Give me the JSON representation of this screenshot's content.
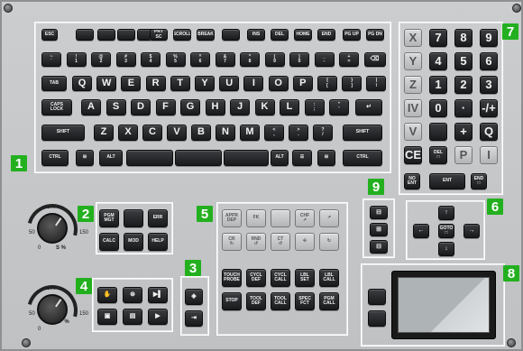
{
  "section_labels": {
    "1": "1",
    "2": "2",
    "3": "3",
    "4": "4",
    "5": "5",
    "6": "6",
    "7": "7",
    "8": "8",
    "9": "9"
  },
  "keyboard": {
    "row1": [
      "ESC",
      "",
      "",
      "",
      "",
      "PRT\nSC",
      "SCROLL",
      "BREAK",
      "",
      "INS",
      "DEL",
      "HOME",
      "END",
      "PG UP",
      "PG DN"
    ],
    "row2": [
      "~\n`",
      "!\n1",
      "@\n2",
      "#\n3",
      "$\n4",
      "%\n5",
      "^\n6",
      "&\n7",
      "*\n8",
      "(\n9",
      ")\n0",
      "_\n-",
      "+\n=",
      "⌫"
    ],
    "row3": [
      "TAB",
      "Q",
      "W",
      "E",
      "R",
      "T",
      "Y",
      "U",
      "I",
      "O",
      "P",
      "{\n[",
      "}\n]",
      "|\n\\"
    ],
    "row4": [
      "CAPS\nLOCK",
      "A",
      "S",
      "D",
      "F",
      "G",
      "H",
      "J",
      "K",
      "L",
      ":\n;",
      "\"\n'",
      "↵"
    ],
    "row5": [
      "SHIFT",
      "Z",
      "X",
      "C",
      "V",
      "B",
      "N",
      "M",
      "<\n,",
      ">\n.",
      "?\n/",
      "SHIFT"
    ],
    "row6": [
      "CTRL",
      "⊞",
      "ALT",
      "",
      "",
      "",
      "ALT",
      "☰",
      "⊞",
      "CTRL"
    ]
  },
  "numpad": {
    "rows": [
      [
        "X",
        "7",
        "8",
        "9"
      ],
      [
        "Y",
        "4",
        "5",
        "6"
      ],
      [
        "Z",
        "1",
        "2",
        "3"
      ],
      [
        "IV",
        "0",
        "·",
        "-/+"
      ],
      [
        "V",
        "",
        "+",
        "Q"
      ],
      [
        "CE",
        "DEL\n□",
        "P",
        "I"
      ],
      [
        "NO\nENT",
        "ENT",
        "",
        "END\n□"
      ]
    ]
  },
  "section2": [
    "PGM\nMGT",
    "",
    "ERR",
    "CALC",
    "MOD",
    "HELP"
  ],
  "section3": [
    "◈",
    "⇥"
  ],
  "section4": [
    "✋",
    "⊛",
    "▶▌",
    "▣",
    "▤",
    "▶"
  ],
  "section5": [
    "APPR\nDEP",
    "FK",
    "",
    "CHF\n↗",
    "↗",
    "CR\n↻",
    "RND\n↺",
    "CT\n↺",
    "✣",
    "↻",
    "TOUCH\nPROBE",
    "CYCL\nDEF",
    "CYCL\nCALL",
    "LBL\nSET",
    "LBL\nCALL",
    "STOP",
    "TOOL\nDEF",
    "TOOL\nCALL",
    "SPEC\nFCT",
    "PGM\nCALL"
  ],
  "section6": {
    "up": "↑",
    "left": "←",
    "goto": "GOTO\n□",
    "right": "→",
    "down": "↓"
  },
  "section9": [
    "⊟",
    "⊞",
    "⊟"
  ],
  "knobs": {
    "top_ticks": [
      "100",
      "50",
      "0",
      "150"
    ],
    "top_label": "S %",
    "bot_ticks": [
      "100",
      "50",
      "0",
      "150"
    ],
    "bot_label": "F %"
  }
}
